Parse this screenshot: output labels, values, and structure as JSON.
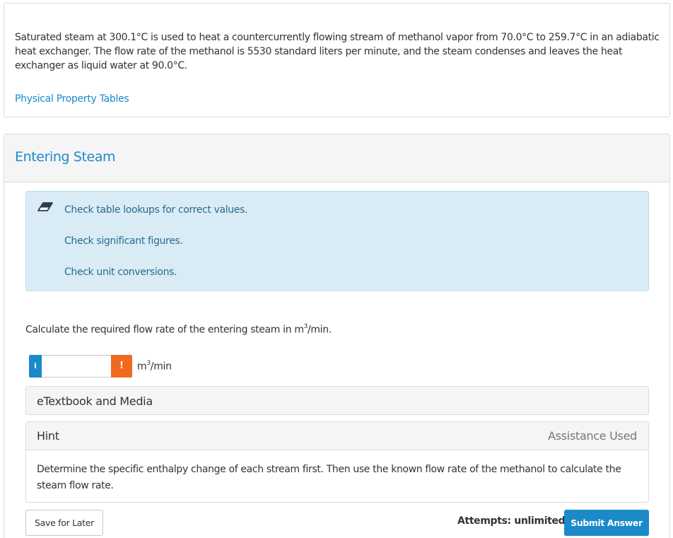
{
  "problem": {
    "text": "Saturated steam at 300.1°C is used to heat a countercurrently flowing stream of methanol vapor from 70.0°C to 259.7°C in an adiabatic heat exchanger. The flow rate of the methanol is 5530 standard liters per minute, and the steam condenses and leaves the heat exchanger as liquid water at 90.0°C.",
    "link_label": "Physical Property Tables"
  },
  "part": {
    "title": "Entering Steam",
    "tips": [
      "Check table lookups for correct values.",
      "Check significant figures.",
      "Check unit conversions."
    ],
    "question_prefix": "Calculate the required flow rate of the entering steam in m",
    "question_sup": "3",
    "question_suffix": "/min.",
    "answer": {
      "value": "",
      "info_label": "i",
      "warn_label": "!",
      "unit_prefix": "m",
      "unit_sup": "3",
      "unit_suffix": "/min"
    },
    "etextbook_label": "eTextbook and Media",
    "hint": {
      "title": "Hint",
      "status": "Assistance Used",
      "text": "Determine the specific enthalpy change of each stream first. Then use the known flow rate of the methanol to calculate the steam flow rate."
    },
    "save_label": "Save for Later",
    "attempts_label": "Attempts: unlimited",
    "submit_label": "Submit Answer"
  },
  "colors": {
    "accent": "#1a8ac9",
    "warning": "#f06a1e",
    "tips_background": "#d9ecf6"
  },
  "icons": {
    "tips": "eraser-icon",
    "answer_info": "info-icon",
    "answer_warning": "warning-icon"
  }
}
